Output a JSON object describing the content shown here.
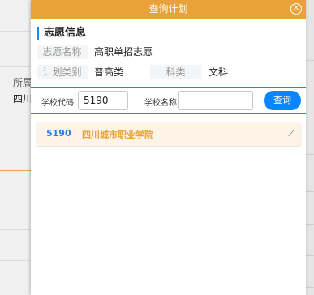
{
  "background": {
    "field_label_fragment": "所属",
    "field_value_fragment": "四川"
  },
  "dialog": {
    "title": "查询计划",
    "close_icon": "close-circle-icon",
    "section_title": "志愿信息",
    "info": {
      "volunteer_name_label": "志愿名称",
      "volunteer_name_value": "高职单招志愿",
      "plan_type_label": "计划类别",
      "plan_type_value": "普高类",
      "subject_label": "科类",
      "subject_value": "文科"
    },
    "search": {
      "school_code_label": "学校代码",
      "school_code_value": "5190",
      "school_name_label": "学校名称",
      "school_name_value": "",
      "query_button": "查询"
    },
    "results": [
      {
        "code": "5190",
        "name": "四川城市职业学院",
        "icon": "chevron-icon"
      }
    ]
  },
  "colors": {
    "title_bar": "#e9a237",
    "accent_blue": "#1e88e5",
    "button_blue": "#0a84ff",
    "result_bg": "#fdf3e6"
  }
}
